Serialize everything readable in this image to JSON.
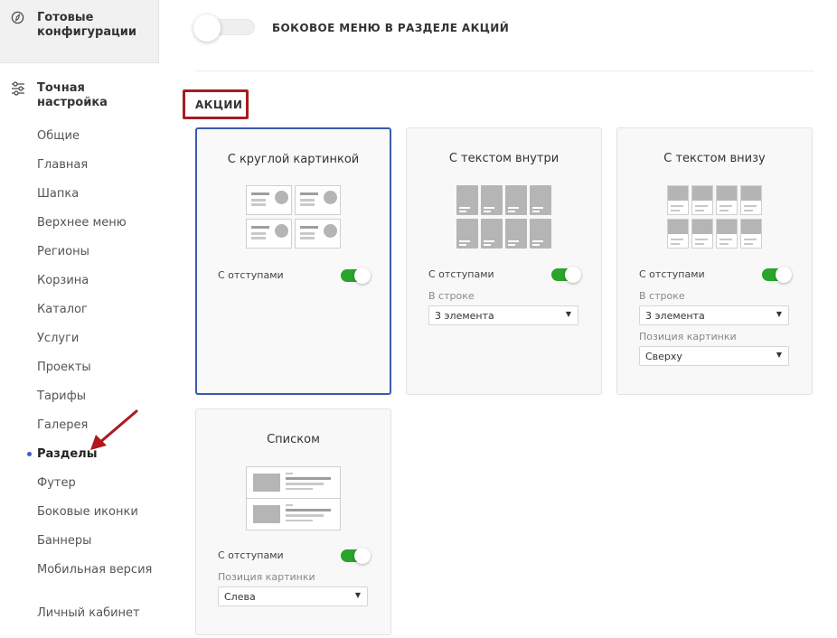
{
  "sidebar": {
    "ready": {
      "label": "Готовые конфигурации",
      "icon": "compass-icon"
    },
    "fine": {
      "label": "Точная настройка",
      "icon": "sliders-icon"
    },
    "items": [
      {
        "label": "Общие"
      },
      {
        "label": "Главная"
      },
      {
        "label": "Шапка"
      },
      {
        "label": "Верхнее меню"
      },
      {
        "label": "Регионы"
      },
      {
        "label": "Корзина"
      },
      {
        "label": "Каталог"
      },
      {
        "label": "Услуги"
      },
      {
        "label": "Проекты"
      },
      {
        "label": "Тарифы"
      },
      {
        "label": "Галерея"
      },
      {
        "label": "Разделы",
        "active": true
      },
      {
        "label": "Футер"
      },
      {
        "label": "Боковые иконки"
      },
      {
        "label": "Баннеры"
      },
      {
        "label": "Мобильная версия"
      },
      {
        "label": "Личный кабинет"
      }
    ]
  },
  "top_toggle": {
    "label": "БОКОВОЕ МЕНЮ В РАЗДЕЛЕ АКЦИЙ",
    "on": false
  },
  "section": {
    "title": "АКЦИИ"
  },
  "cards": [
    {
      "title": "С круглой картинкой",
      "selected": true,
      "padding_label": "С отступами",
      "padding_on": true
    },
    {
      "title": "С текстом внутри",
      "selected": false,
      "padding_label": "С отступами",
      "padding_on": true,
      "row_label": "В строке",
      "row_value": "3 элемента"
    },
    {
      "title": "С текстом внизу",
      "selected": false,
      "padding_label": "С отступами",
      "padding_on": true,
      "row_label": "В строке",
      "row_value": "3 элемента",
      "position_label": "Позиция картинки",
      "position_value": "Сверху"
    },
    {
      "title": "Списком",
      "selected": false,
      "padding_label": "С отступами",
      "padding_on": true,
      "position_label": "Позиция картинки",
      "position_value": "Слева"
    }
  ],
  "colors": {
    "accent_border": "#3b5ca8",
    "toggle_on": "#2aa42a",
    "highlight_box": "#a31d22",
    "annotation_arrow": "#b0181e",
    "active_dot": "#3d5fc4"
  }
}
